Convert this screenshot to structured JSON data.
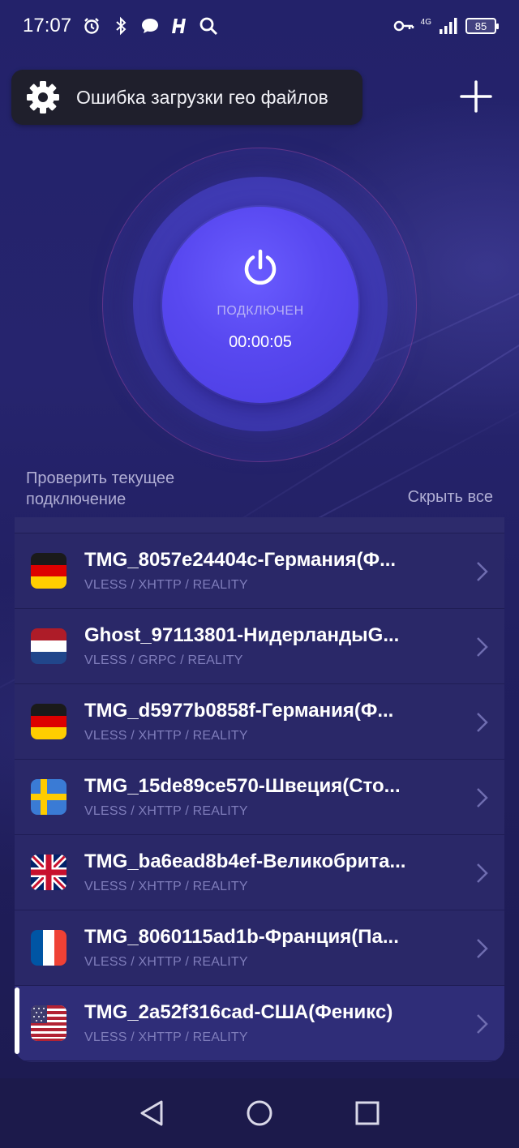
{
  "status_bar": {
    "time": "17:07",
    "network": "4G",
    "battery": "85"
  },
  "toast": {
    "message": "Ошибка загрузки гео файлов"
  },
  "connection": {
    "state": "ПОДКЛЮЧЕН",
    "timer": "00:00:05"
  },
  "actions": {
    "check_connection": "Проверить текущее подключение",
    "hide_all": "Скрыть все"
  },
  "servers": [
    {
      "name": "TMG_8057e24404c-Германия(Ф...",
      "protocol": "VLESS / XHTTP / REALITY",
      "flag": "germany-flag"
    },
    {
      "name": "Ghost_97113801-НидерландыG...",
      "protocol": "VLESS / GRPC / REALITY",
      "flag": "netherlands-flag"
    },
    {
      "name": "TMG_d5977b0858f-Германия(Ф...",
      "protocol": "VLESS / XHTTP / REALITY",
      "flag": "germany-flag"
    },
    {
      "name": "TMG_15de89ce570-Швеция(Сто...",
      "protocol": "VLESS / XHTTP / REALITY",
      "flag": "sweden-flag"
    },
    {
      "name": "TMG_ba6ead8b4ef-Великобрита...",
      "protocol": "VLESS / XHTTP / REALITY",
      "flag": "uk-flag"
    },
    {
      "name": "TMG_8060115ad1b-Франция(Па...",
      "protocol": "VLESS / XHTTP / REALITY",
      "flag": "france-flag"
    },
    {
      "name": "TMG_2a52f316cad-США(Феникс)",
      "protocol": "VLESS / XHTTP / REALITY",
      "flag": "usa-flag"
    }
  ],
  "colors": {
    "background": "#23226a",
    "power_button": "#5848f0",
    "list_bg": "#2a2868",
    "secondary_text": "#7f7dbb"
  }
}
